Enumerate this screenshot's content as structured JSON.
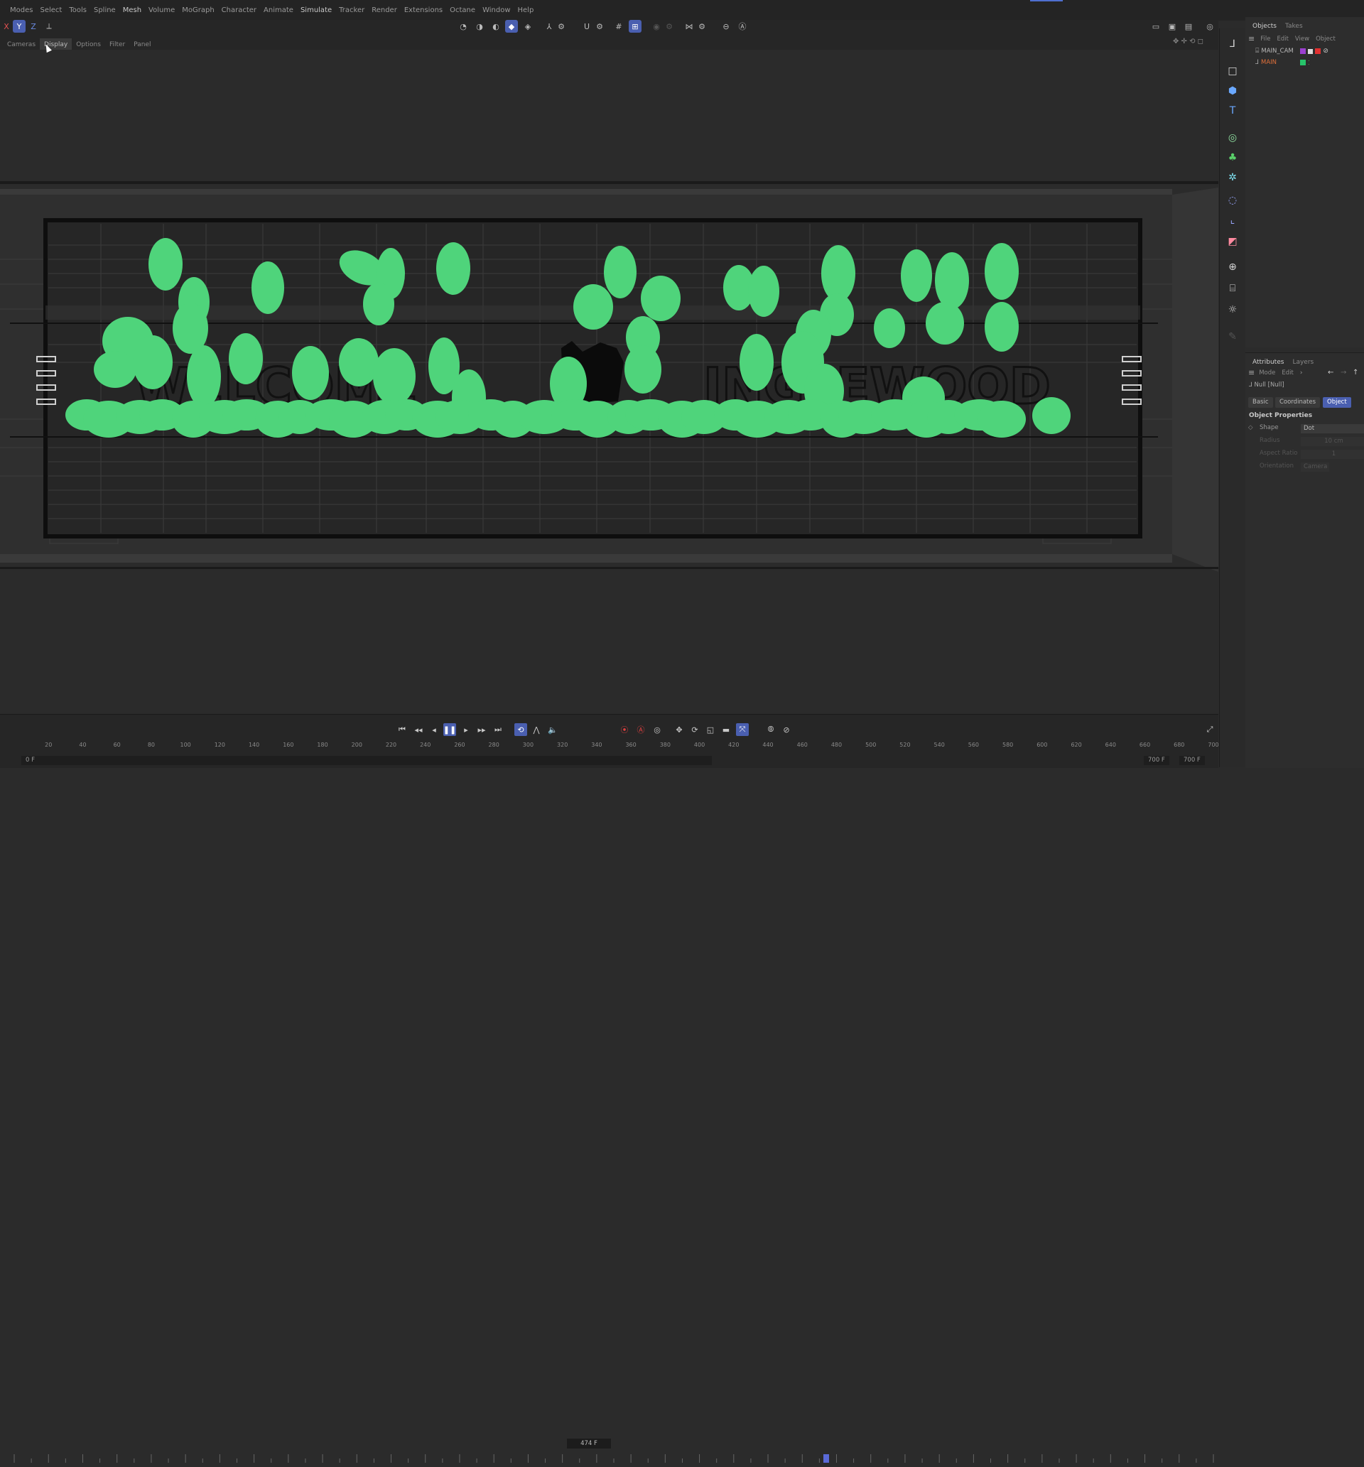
{
  "menubar": {
    "items": [
      "Modes",
      "Select",
      "Tools",
      "Spline",
      "Mesh",
      "Volume",
      "MoGraph",
      "Character",
      "Animate",
      "Simulate",
      "Tracker",
      "Render",
      "Extensions",
      "Octane",
      "Window",
      "Help"
    ],
    "axis_labels": [
      "X",
      "Y",
      "Z"
    ]
  },
  "viewport_tabs": [
    "Cameras",
    "Display",
    "Options",
    "Filter",
    "Panel"
  ],
  "viewport": {
    "sign_text_left": "WELCOME",
    "sign_text_right": "INGLEWOOD",
    "accent_color": "#4fd47b"
  },
  "objects_panel": {
    "tabs": [
      "Objects",
      "Takes"
    ],
    "menu": [
      "File",
      "Edit",
      "View",
      "Object"
    ],
    "objects": [
      {
        "name": "MAIN_CAM",
        "color": "#b8b8b8",
        "tag": "#9b3fd0"
      },
      {
        "name": "MAIN",
        "color": "#e0703a",
        "tag": "#27c46a"
      }
    ]
  },
  "attributes_panel": {
    "tabs": [
      "Attributes",
      "Layers"
    ],
    "menu": [
      "Mode",
      "Edit"
    ],
    "object_name": "Null [Null]",
    "sub_tabs": [
      "Basic",
      "Coordinates",
      "Object"
    ],
    "section": "Object Properties",
    "fields": [
      {
        "label": "Shape",
        "value": "Dot"
      },
      {
        "label": "Radius",
        "value": "10 cm"
      },
      {
        "label": "Aspect Ratio",
        "value": "1"
      },
      {
        "label": "Orientation",
        "value": "Camera"
      }
    ]
  },
  "timeline": {
    "current_frame": "474 F",
    "start_field": "0 F",
    "end_field_1": "700 F",
    "end_field_2": "700 F",
    "ticks": [
      "20",
      "40",
      "60",
      "80",
      "100",
      "120",
      "140",
      "160",
      "180",
      "200",
      "220",
      "240",
      "260",
      "280",
      "300",
      "320",
      "340",
      "360",
      "380",
      "400",
      "420",
      "440",
      "460",
      "480",
      "500",
      "520",
      "540",
      "560",
      "580",
      "600",
      "620",
      "640",
      "660",
      "680",
      "700"
    ],
    "playhead_frame": 474
  }
}
